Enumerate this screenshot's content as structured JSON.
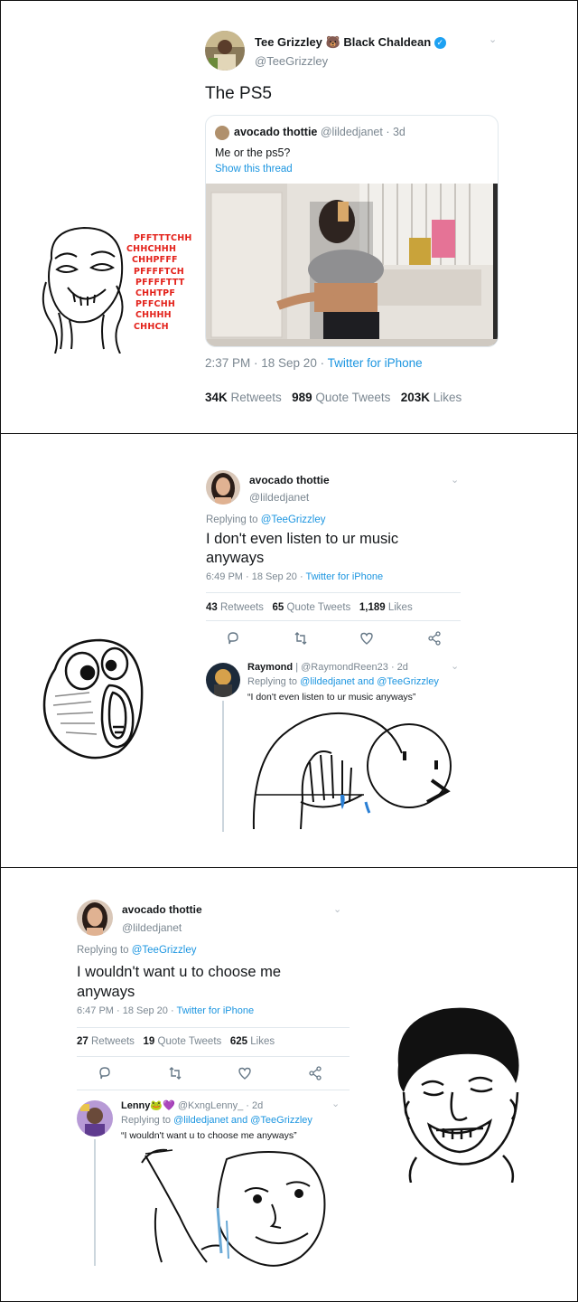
{
  "panel1": {
    "author": {
      "name": "Tee Grizzley",
      "emoji": "🐻",
      "name2": "Black Chaldean",
      "handle": "@TeeGrizzley"
    },
    "text": "The PS5",
    "quote": {
      "name": "avocado thottie",
      "handle": "@lildedjanet",
      "age": "· 3d",
      "text": "Me or the ps5?",
      "show_thread": "Show this thread"
    },
    "meta": {
      "time": "2:37 PM · 18 Sep 20 · ",
      "source": "Twitter for iPhone"
    },
    "stats": {
      "retweets": "34K",
      "retweets_label": "Retweets",
      "quotes": "989",
      "quotes_label": "Quote Tweets",
      "likes": "203K",
      "likes_label": "Likes"
    },
    "meme_text": [
      "PFFTTTCHH",
      "CHHCHHH",
      "CHHPFFF",
      "PFFFFTCH",
      "PFFFFTTT",
      "CHHTPF",
      "PFFCHH",
      "CHHHH",
      "CHHCH"
    ]
  },
  "panel2": {
    "author": {
      "name": "avocado thottie",
      "handle": "@lildedjanet"
    },
    "replying": {
      "prefix": "Replying to ",
      "to": "@TeeGrizzley"
    },
    "text_line1": "I don't even listen to ur music",
    "text_line2": "anyways",
    "meta": {
      "time": "6:49 PM · 18 Sep 20 · ",
      "source": "Twitter for iPhone"
    },
    "stats": {
      "retweets": "43",
      "retweets_label": "Retweets",
      "quotes": "65",
      "quotes_label": "Quote Tweets",
      "likes": "1,189",
      "likes_label": "Likes"
    },
    "reply": {
      "name": "Raymond",
      "sep": "|",
      "handle": "@RaymondReen23",
      "age": "· 2d",
      "replying_prefix": "Replying to ",
      "replying_to": "@lildedjanet and @TeeGrizzley",
      "text": "“I don't even listen to ur music anyways”"
    }
  },
  "panel3": {
    "author": {
      "name": "avocado thottie",
      "handle": "@lildedjanet"
    },
    "replying": {
      "prefix": "Replying to ",
      "to": "@TeeGrizzley"
    },
    "text_line1": "I wouldn't want u to choose me",
    "text_line2": "anyways",
    "meta": {
      "time": "6:47 PM · 18 Sep 20 · ",
      "source": "Twitter for iPhone"
    },
    "stats": {
      "retweets": "27",
      "retweets_label": "Retweets",
      "quotes": "19",
      "quotes_label": "Quote Tweets",
      "likes": "625",
      "likes_label": "Likes"
    },
    "reply": {
      "name": "Lenny",
      "emoji": "🐸💜",
      "handle": "@KxngLenny_",
      "age": "· 2d",
      "replying_prefix": "Replying to ",
      "replying_to": "@lildedjanet and @TeeGrizzley",
      "text": "“I wouldn't want u to choose me anyways”"
    }
  },
  "icons": {
    "chevron": "⌄",
    "verified": "✓"
  },
  "colors": {
    "link": "#1b95e0",
    "muted": "#7b8791",
    "scream": "#e3221b"
  }
}
